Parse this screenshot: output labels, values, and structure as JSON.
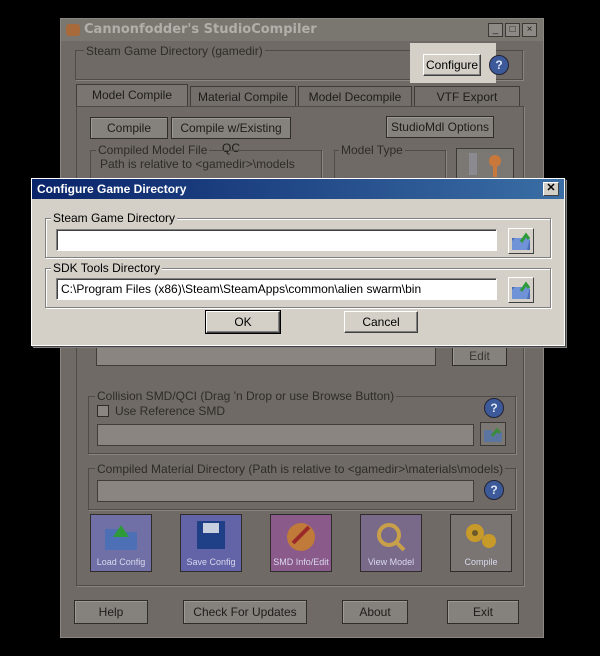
{
  "main_window": {
    "title": "Cannonfodder's StudioCompiler",
    "steam_dir_label": "Steam Game Directory (gamedir)",
    "configure_label": "Configure",
    "tabs": [
      "Model Compile",
      "Material Compile",
      "Model Decompile",
      "VTF Export"
    ],
    "compile_model_label": "Compile Model",
    "compile_existing_label": "Compile w/Existing QC",
    "studiomdl_options_label": "StudioMdl Options",
    "compiled_model_file_label": "Compiled Model File",
    "path_relative_label": "Path is relative to <gamedir>\\models",
    "model_type_label": "Model Type",
    "edit_label": "Edit",
    "collision_label": "Collision SMD/QCI (Drag 'n Drop or use Browse Button)",
    "use_reference_label": "Use Reference SMD",
    "compiled_material_label": "Compiled Material Directory (Path is relative to <gamedir>\\materials\\models)",
    "tool_buttons": [
      "Load Config",
      "Save Config",
      "SMD Info/Edit",
      "View Model",
      "Compile"
    ],
    "footer_buttons": [
      "Help",
      "Check For Updates",
      "About",
      "Exit"
    ],
    "help_glyph": "?"
  },
  "dialog": {
    "title": "Configure Game Directory",
    "close_glyph": "✕",
    "steam_group_label": "Steam Game Directory",
    "steam_value": "",
    "sdk_group_label": "SDK Tools Directory",
    "sdk_value": "C:\\Program Files (x86)\\Steam\\SteamApps\\common\\alien swarm\\bin",
    "ok_label": "OK",
    "cancel_label": "Cancel"
  },
  "icons": {
    "folder": "folder-open-icon",
    "help": "help-icon"
  },
  "colors": {
    "dialog_title_start": "#0a246a",
    "dialog_title_end": "#3a6ea5",
    "dialog_face": "#d4d0c8",
    "dim_window": "#6f6a65"
  }
}
